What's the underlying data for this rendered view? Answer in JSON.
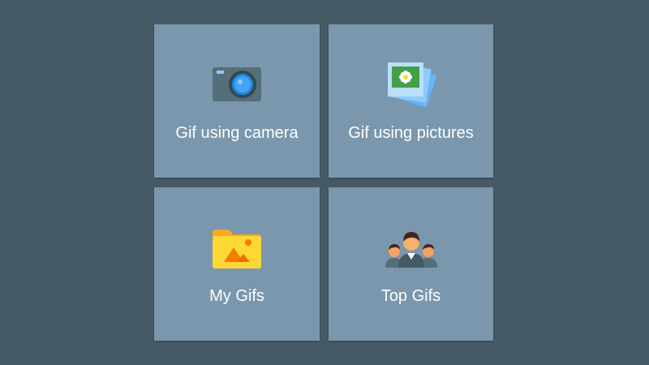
{
  "tiles": [
    {
      "label": "Gif using camera",
      "icon": "camera-icon"
    },
    {
      "label": "Gif using pictures",
      "icon": "photo-stack-icon"
    },
    {
      "label": "My Gifs",
      "icon": "folder-image-icon"
    },
    {
      "label": "Top Gifs",
      "icon": "people-group-icon"
    }
  ],
  "colors": {
    "background": "#455a64",
    "tile": "#7a97ad",
    "text": "#ffffff"
  }
}
